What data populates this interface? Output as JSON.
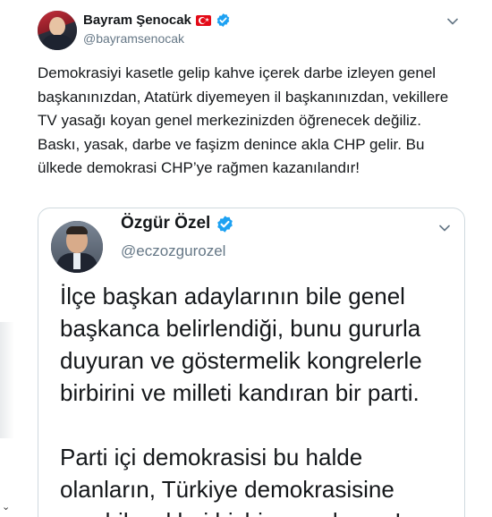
{
  "tweet": {
    "author_name": "Bayram Şenocak",
    "author_handle": "@bayramsenocak",
    "text": "Demokrasiyi kasetle gelip kahve içerek darbe izleyen genel başkanınızdan, Atatürk diyemeyen il başkanınızdan, vekillere TV yasağı koyan genel merkezinizden öğrenecek değiliz. Baskı, yasak, darbe ve faşizm denince akla CHP gelir. Bu ülkede demokrasi CHP’ye rağmen kazanılandır!"
  },
  "quote": {
    "author_name": "Özgür Özel",
    "author_handle": "@eczozgurozel",
    "paragraph_1": "İlçe başkan adaylarının bile genel başkanca belirlendiği, bunu gururla duyuran ve göstermelik kongrelerle birbirini ve milleti kandıran bir parti.",
    "paragraph_2": "Parti içi demokrasisi bu halde olanların, Türkiye demokrasisine verebilecekleri hiçbir şey olamaz!"
  },
  "icons": {
    "verified": "verified-badge-icon",
    "flag": "turkey-flag-icon",
    "more": "chevron-down-icon"
  },
  "colors": {
    "accent": "#1da1f2",
    "text": "#14171a",
    "secondary": "#657786",
    "border": "#cfd9de"
  }
}
